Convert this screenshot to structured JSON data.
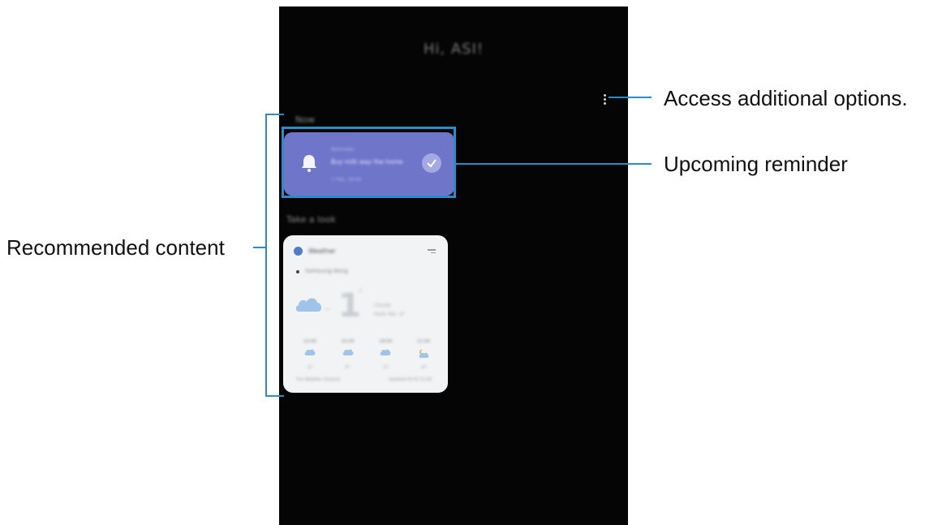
{
  "screen": {
    "greeting": "Hi, ASI!",
    "sections": {
      "now": "Now",
      "take_a_look": "Take a look"
    }
  },
  "reminder_card": {
    "meta": "Reminder",
    "title": "Buy milk way the home",
    "date": "1 Feb, 18:00"
  },
  "weather_card": {
    "title": "Weather",
    "location": "Samsung-dong",
    "temperature": "1",
    "degree": "°",
    "condition": "Cloudy",
    "feels": "Feels like -4°",
    "forecast": [
      {
        "time": "12:00",
        "temp": "-1°",
        "icon": "cloud-icon"
      },
      {
        "time": "15:00",
        "temp": "0°",
        "icon": "cloud-icon"
      },
      {
        "time": "18:00",
        "temp": "-2°",
        "icon": "cloud-icon"
      },
      {
        "time": "21:00",
        "temp": "-4°",
        "icon": "moon-cloud-icon"
      }
    ],
    "source": "The Weather Channel",
    "updated": "Updated 03.02 11:00"
  },
  "callouts": {
    "options": "Access additional options.",
    "reminder": "Upcoming reminder",
    "recommended": "Recommended content"
  },
  "colors": {
    "phone_bg": "#050505",
    "reminder_bg": "#6f75c9",
    "highlight": "#2a8cc8",
    "weather_bg": "#f1f3f4"
  }
}
